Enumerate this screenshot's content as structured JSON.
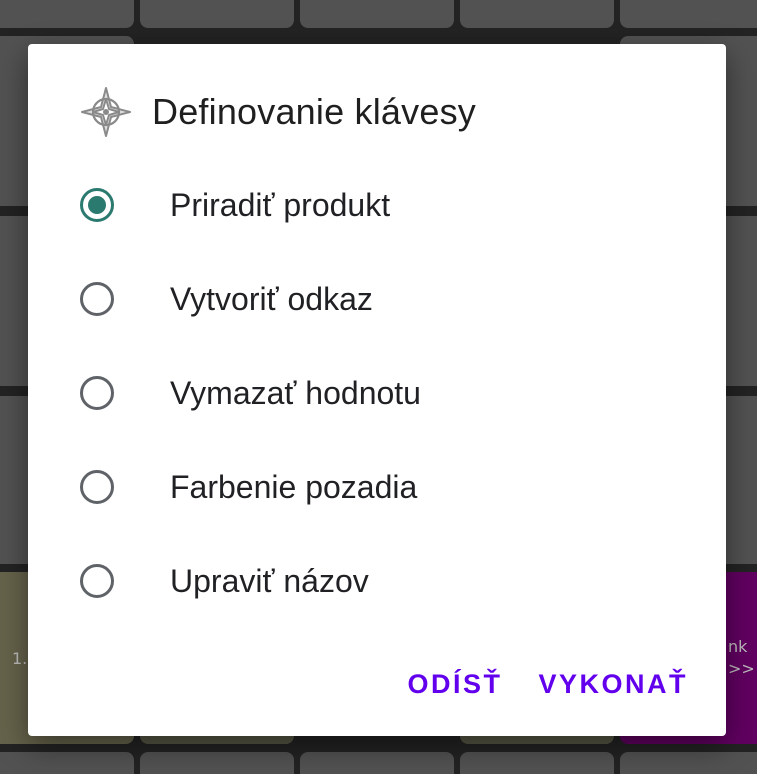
{
  "dialog": {
    "title": "Definovanie klávesy",
    "options": [
      {
        "label": "Priradiť produkt",
        "checked": true
      },
      {
        "label": "Vytvoriť odkaz",
        "checked": false
      },
      {
        "label": "Vymazať hodnotu",
        "checked": false
      },
      {
        "label": "Farbenie pozadia",
        "checked": false
      },
      {
        "label": "Upraviť názov",
        "checked": false
      }
    ],
    "buttons": {
      "cancel": "ODÍSŤ",
      "confirm": "VYKONAŤ"
    }
  },
  "background": {
    "left_fragment": "1.",
    "right_fragment_line1": "nk",
    "right_fragment_line2": ">>"
  },
  "colors": {
    "accent_radio": "#2b7a6f",
    "button_text": "#6200ee",
    "key_gray": "#595959",
    "key_olive": "#6f6c52",
    "key_purple": "#6a006a"
  },
  "icons": {
    "title": "compass-icon"
  }
}
